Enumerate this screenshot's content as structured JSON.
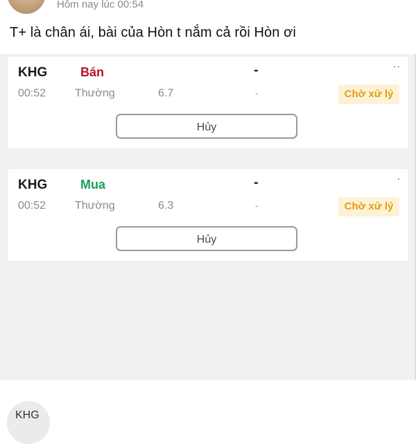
{
  "post": {
    "timestamp": "Hôm nay lúc 00:54",
    "text": "T+ là chân ái, bài của Hòn t nắm cả rồi Hòn ơi"
  },
  "orders": [
    {
      "code": "KHG",
      "side": "Bán",
      "side_color": "#b3142b",
      "top_dash": "-",
      "menu": "··",
      "time": "00:52",
      "type": "Thường",
      "price": "6.7",
      "mid_dash": "-",
      "status": "Chờ xử lý",
      "cancel_label": "Hủy"
    },
    {
      "code": "KHG",
      "side": "Mua",
      "side_color": "#18a05a",
      "top_dash": "-",
      "menu": "·",
      "time": "00:52",
      "type": "Thường",
      "price": "6.3",
      "mid_dash": "-",
      "status": "Chờ xử lý",
      "cancel_label": "Hủy"
    }
  ],
  "next_post": {
    "code": "KHG"
  },
  "colors": {
    "status_text": "#e39b12",
    "status_bg": "#fdf2d6",
    "panel_bg": "#f1f1f1"
  }
}
